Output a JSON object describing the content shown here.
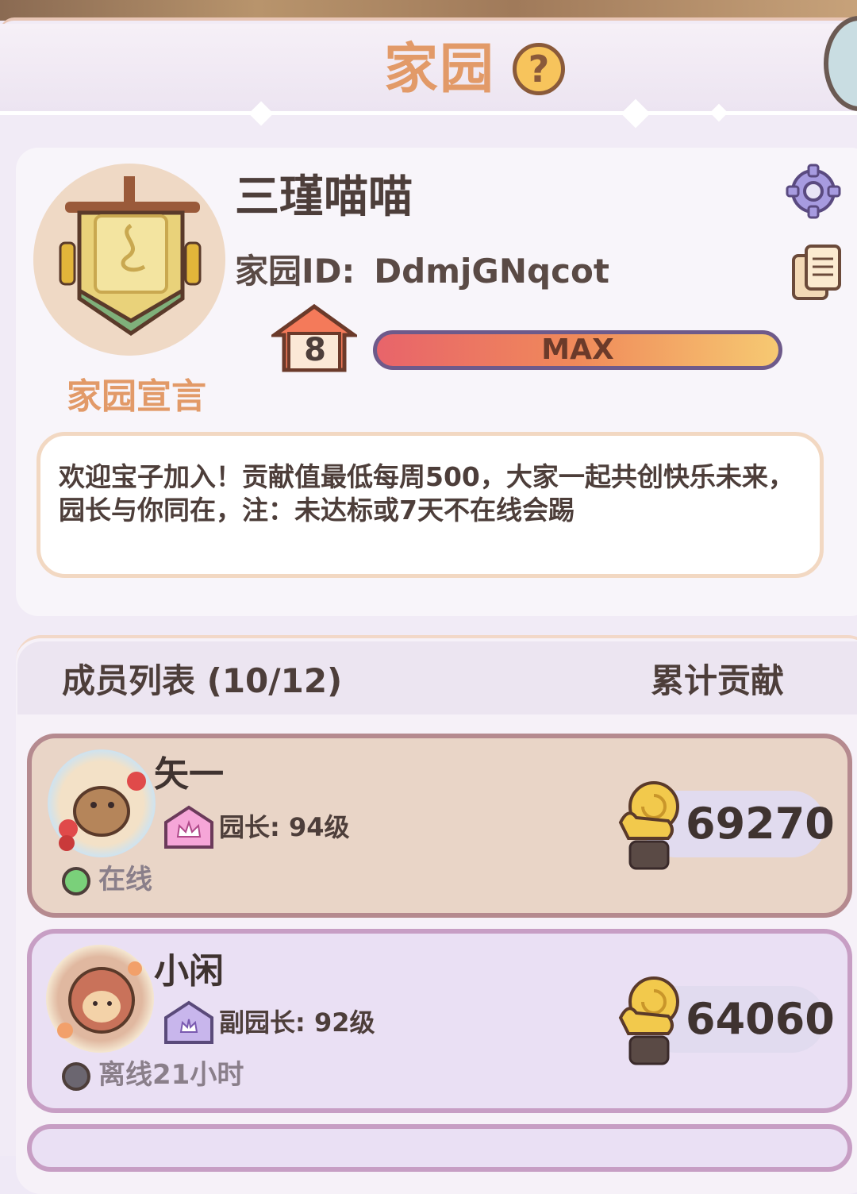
{
  "header": {
    "title": "家园",
    "help_symbol": "?"
  },
  "home": {
    "name": "三瑾喵喵",
    "id_label": "家园ID:",
    "id_value": "DdmjGNqcot",
    "level": "8",
    "progress_label": "MAX",
    "progress_fraction": 1.0,
    "manifesto_label": "家园宣言",
    "manifesto_text": "欢迎宝子加入！贡献值最低每周500，大家一起共创快乐未来，园长与你同在，注：未达标或7天不在线会踢"
  },
  "members": {
    "title": "成员列表 (10/12)",
    "column_label": "累计贡献",
    "items": [
      {
        "name": "矢一",
        "role": "园长: 94级",
        "status": "在线",
        "status_color": "#7ad07a",
        "contribution": "69270"
      },
      {
        "name": "小闲",
        "role": "副园长: 92级",
        "status": "离线21小时",
        "status_color": "#6b6670",
        "contribution": "64060"
      }
    ]
  },
  "colors": {
    "accent": "#e29a68",
    "text": "#4d3e3a",
    "leader_card": "#e9d5c7",
    "member_card": "#eae0f4"
  }
}
